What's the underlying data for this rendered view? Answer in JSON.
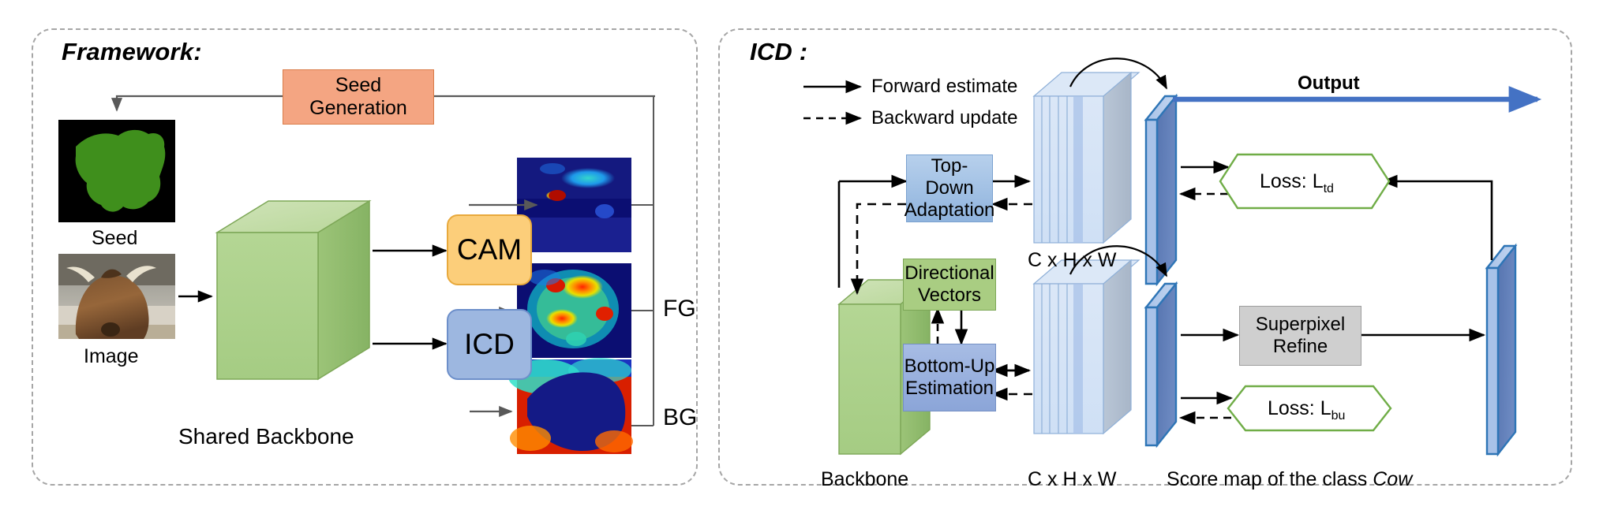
{
  "figure": {
    "left_panel_title": "Framework:",
    "right_panel_title": "ICD :"
  },
  "left_panel": {
    "seed_generation_label": "Seed\nGeneration",
    "seed_generation_line1": "Seed",
    "seed_generation_line2": "Generation",
    "cam_label": "CAM",
    "icd_label": "ICD",
    "seed_caption": "Seed",
    "image_caption": "Image",
    "backbone_caption": "Shared Backbone",
    "fg_label": "FG",
    "bg_label": "BG",
    "thumbnails": [
      {
        "name": "seed-mask",
        "caption": "Seed"
      },
      {
        "name": "input-image",
        "caption": "Image"
      },
      {
        "name": "cam-heatmap",
        "caption": ""
      },
      {
        "name": "icd-fg-heatmap",
        "caption": ""
      },
      {
        "name": "icd-bg-heatmap",
        "caption": ""
      }
    ]
  },
  "right_panel": {
    "legend": [
      {
        "style": "solid",
        "label": "Forward estimate"
      },
      {
        "style": "dashed",
        "label": "Backward update"
      }
    ],
    "top_down_line1": "Top-Down",
    "top_down_line2": "Adaptation",
    "bottom_up_line1": "Bottom-Up",
    "bottom_up_line2": "Estimation",
    "directional_line1": "Directional",
    "directional_line2": "Vectors",
    "superpixel_line1": "Superpixel",
    "superpixel_line2": "Refine",
    "loss_td_prefix": "Loss: L",
    "loss_td_sub": "td",
    "loss_bu_prefix": "Loss: L",
    "loss_bu_sub": "bu",
    "output_label": "Output",
    "backbone_caption": "Backbone",
    "feature_caption_top": "C x H x W",
    "feature_caption_bottom": "C x H x W",
    "scoremap_caption_prefix": "Score map of the class ",
    "scoremap_caption_class": "Cow"
  },
  "colors": {
    "panel_border": "#a6a6a6",
    "seed_gen_fill": "#f4a582",
    "cam_fill": "#fcce7a",
    "icd_fill": "#9db7e0",
    "backbone_green": "#a9cd82",
    "directional_green": "#a9cd82",
    "loss_green": "#70ad47",
    "output_blue": "#4472c4",
    "scoremap_blue": "#5b7ab5",
    "superpixel_gray": "#cfcfcf",
    "arrow_black": "#000000"
  }
}
